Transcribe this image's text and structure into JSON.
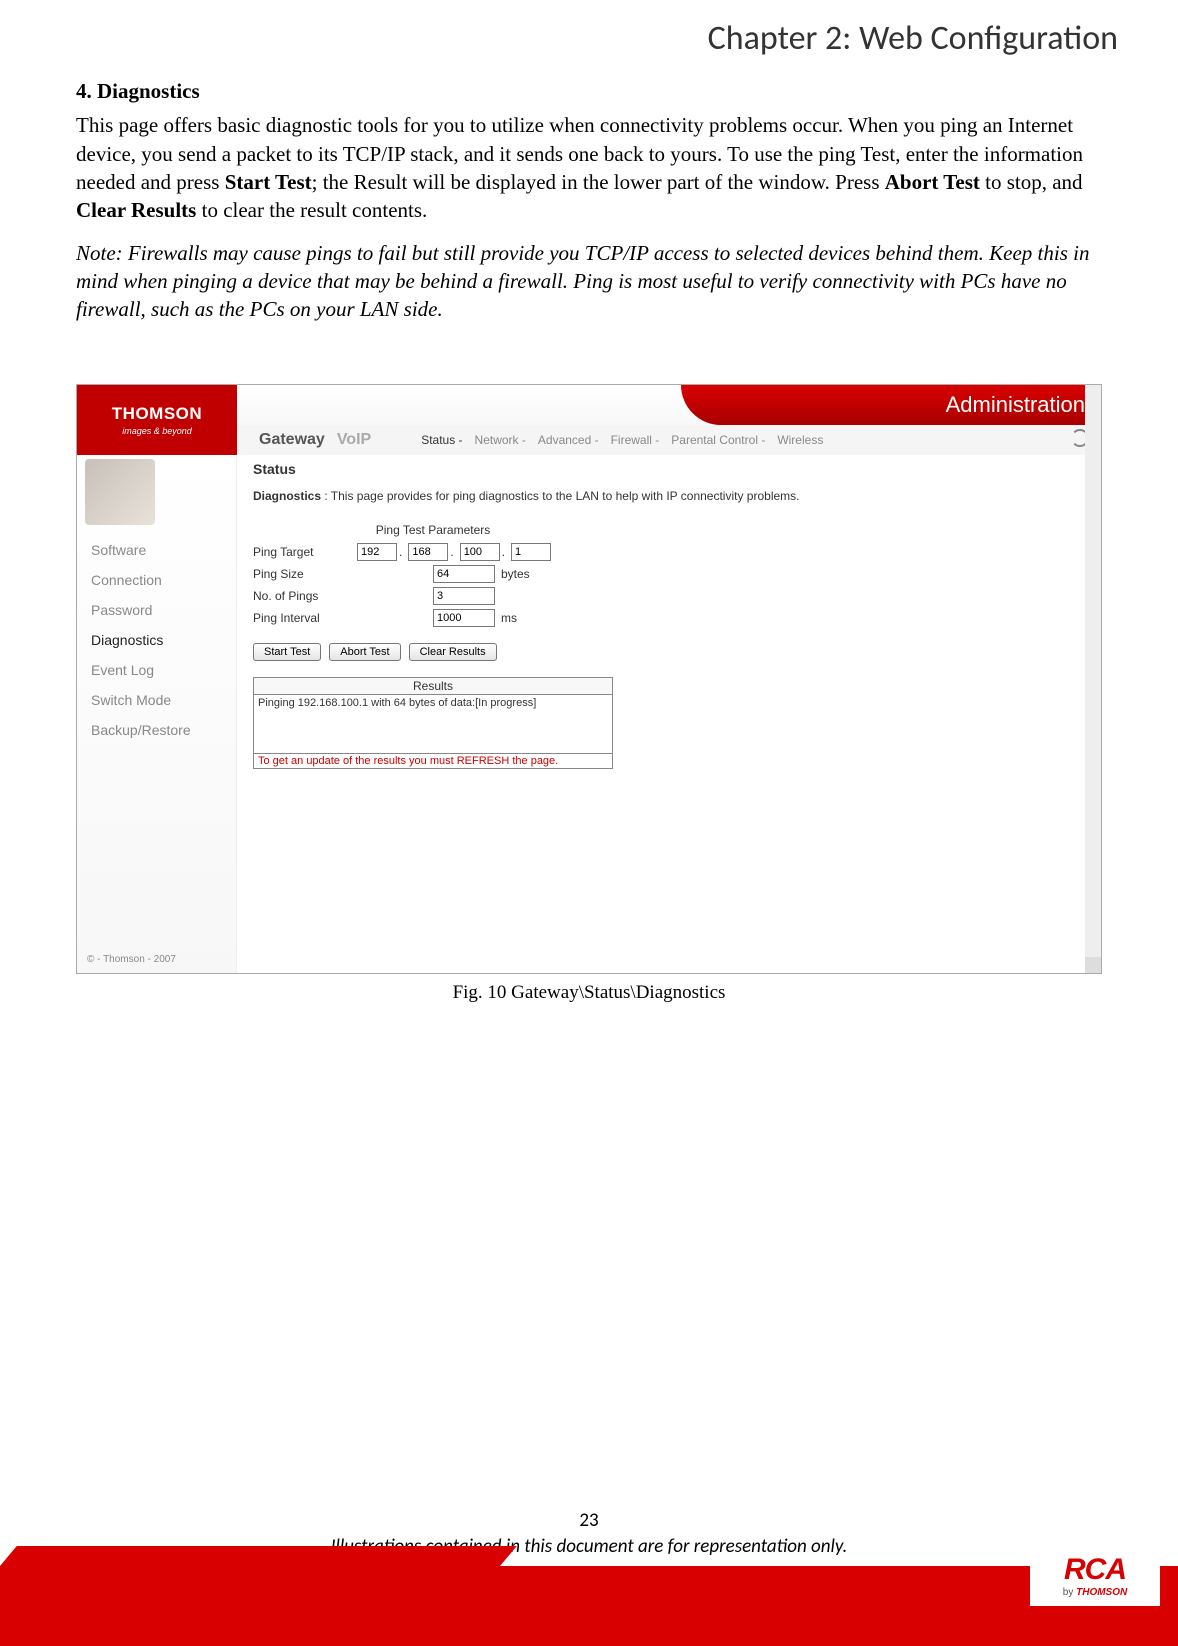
{
  "chapter_title": "Chapter 2: Web Configuration",
  "section": {
    "title": "4. Diagnostics",
    "paragraph_pre": "This page offers basic diagnostic tools for you to utilize when connectivity problems occur. When you ping an Internet device, you send a packet to its TCP/IP stack, and it sends one back to yours. To use the ping Test, enter the information needed and press ",
    "bold1": "Start Test",
    "mid1": "; the Result will be displayed in the lower part of the window. Press ",
    "bold2": "Abort Test",
    "mid2": " to stop, and ",
    "bold3": "Clear Results",
    "end": " to clear the result contents.",
    "note": "Note: Firewalls may cause pings to fail but still provide you TCP/IP access to selected devices behind them. Keep this in mind when pinging a device that may be behind a firewall. Ping is most useful to verify connectivity with PCs have no firewall, such as the PCs on your LAN side."
  },
  "screenshot": {
    "brand": "THOMSON",
    "brand_sub": "images & beyond",
    "banner": "Administration",
    "nav_main": [
      "Gateway",
      "VoIP"
    ],
    "nav_items": [
      "Status -",
      "Network -",
      "Advanced -",
      "Firewall -",
      "Parental Control -",
      "Wireless"
    ],
    "sidebar": [
      "Software",
      "Connection",
      "Password",
      "Diagnostics",
      "Event Log",
      "Switch Mode",
      "Backup/Restore"
    ],
    "sidebar_active_index": 3,
    "copyright": "© - Thomson - 2007",
    "main_title": "Status",
    "desc_label": "Diagnostics",
    "desc_text": " :  This page provides for ping diagnostics to the LAN to help with IP connectivity problems.",
    "params_title": "Ping Test Parameters",
    "rows": {
      "target_label": "Ping Target",
      "target_ip": [
        "192",
        "168",
        "100",
        "1"
      ],
      "size_label": "Ping Size",
      "size_value": "64",
      "size_unit": "bytes",
      "count_label": "No. of Pings",
      "count_value": "3",
      "interval_label": "Ping Interval",
      "interval_value": "1000",
      "interval_unit": "ms"
    },
    "buttons": [
      "Start Test",
      "Abort Test",
      "Clear Results"
    ],
    "results_title": "Results",
    "results_line": "Pinging 192.168.100.1 with 64 bytes of data:[In progress]",
    "results_footer": "To get an update of the results you must REFRESH the page."
  },
  "caption": "Fig. 10 Gateway\\Status\\Diagnostics",
  "page_number": "23",
  "footer_note": "Illustrations contained in this document are for representation only.",
  "footer_logo": {
    "main": "RCA",
    "by": "by ",
    "brand": "THOMSON"
  }
}
